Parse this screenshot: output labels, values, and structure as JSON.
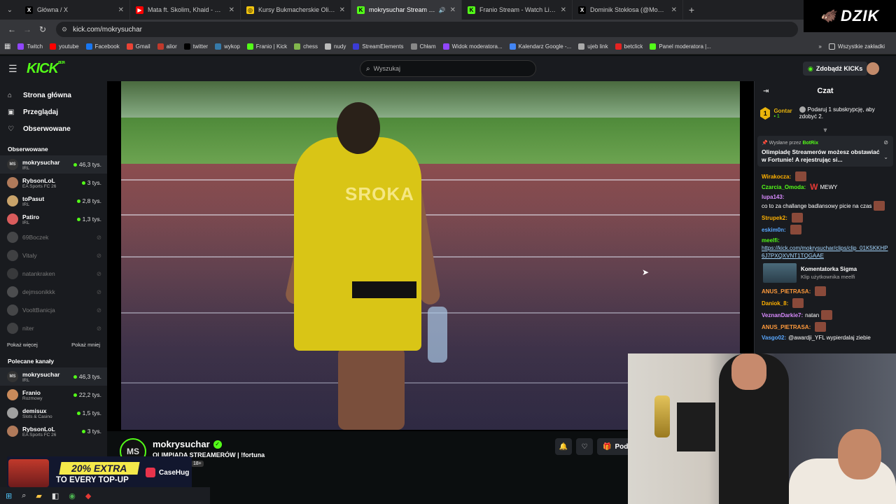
{
  "browser": {
    "tabs": [
      {
        "title": "Główna / X",
        "fav": "X",
        "fav_color": "#000000",
        "fav_text": "#ffffff"
      },
      {
        "title": "Mata ft. Skolim, Khaid - KAMIKA",
        "fav": "▶",
        "fav_color": "#ff0000",
        "fav_text": "#ffffff"
      },
      {
        "title": "Kursy Bukmacherskie Olimpiada",
        "fav": "◎",
        "fav_color": "#f1c40f",
        "fav_text": "#000000"
      },
      {
        "title": "mokrysuchar Stream - Watc",
        "fav": "K",
        "fav_color": "#53fc18",
        "fav_text": "#000000",
        "active": true
      },
      {
        "title": "Franio Stream - Watch Live on K",
        "fav": "K",
        "fav_color": "#53fc18",
        "fav_text": "#000000"
      },
      {
        "title": "Dominik Stokłosa (@MokrySuch",
        "fav": "X",
        "fav_color": "#000000",
        "fav_text": "#ffffff"
      }
    ],
    "url": "kick.com/mokrysuchar",
    "bookmarks": [
      {
        "label": "Twitch",
        "color": "#9146ff"
      },
      {
        "label": "youtube",
        "color": "#ff0000"
      },
      {
        "label": "Facebook",
        "color": "#1877f2"
      },
      {
        "label": "Gmail",
        "color": "#ea4335"
      },
      {
        "label": "alior",
        "color": "#c0392b"
      },
      {
        "label": "twitter",
        "color": "#000000"
      },
      {
        "label": "wykop",
        "color": "#367aa9"
      },
      {
        "label": "Franio | Kick",
        "color": "#53fc18"
      },
      {
        "label": "chess",
        "color": "#81b64c"
      },
      {
        "label": "nudy",
        "color": "#bbbbbb"
      },
      {
        "label": "StreamElements",
        "color": "#3b3bd6"
      },
      {
        "label": "Chłam",
        "color": "#888888"
      },
      {
        "label": "Widok moderatora...",
        "color": "#9146ff"
      },
      {
        "label": "Kalendarz Google -...",
        "color": "#4285f4"
      },
      {
        "label": "ujeb link",
        "color": "#aaaaaa"
      },
      {
        "label": "betclick",
        "color": "#e52321"
      },
      {
        "label": "Panel moderatora |...",
        "color": "#53fc18"
      }
    ],
    "all_bookmarks": "Wszystkie zakładki"
  },
  "dzik_logo": "DZIK",
  "kick": {
    "logo": "KICK",
    "logo_sup": "BETA",
    "search_placeholder": "Wyszukaj",
    "kicks_button": "Zdobądź KICKs"
  },
  "sidebar": {
    "nav": [
      {
        "label": "Strona główna",
        "icon": "⌂"
      },
      {
        "label": "Przeglądaj",
        "icon": "▣"
      },
      {
        "label": "Obserwowane",
        "icon": "♡"
      }
    ],
    "followed_title": "Obserwowane",
    "followed": [
      {
        "name": "mokrysuchar",
        "cat": "IRL",
        "viewers": "46,3 tys.",
        "live": true,
        "av": "MS",
        "color": "#333333"
      },
      {
        "name": "RybsonLoL",
        "cat": "EA Sports FC 26",
        "viewers": "3 tys.",
        "live": true,
        "av": "",
        "color": "#b07a5a"
      },
      {
        "name": "toPasut",
        "cat": "IRL",
        "viewers": "2,8 tys.",
        "live": true,
        "av": "",
        "color": "#c9a36a"
      },
      {
        "name": "Patiro",
        "cat": "IRL",
        "viewers": "1,3 tys.",
        "live": true,
        "av": "",
        "color": "#d95c5c"
      },
      {
        "name": "69Boczek",
        "live": false,
        "av": "",
        "color": "#888888"
      },
      {
        "name": "Vitaly",
        "live": false,
        "av": "",
        "color": "#777777"
      },
      {
        "name": "natankraken",
        "live": false,
        "av": "",
        "color": "#666666"
      },
      {
        "name": "dejmsonikkk",
        "live": false,
        "av": "",
        "color": "#999999"
      },
      {
        "name": "VooltBanicja",
        "live": false,
        "av": "",
        "color": "#888888"
      },
      {
        "name": "niter",
        "live": false,
        "av": "",
        "color": "#777777"
      }
    ],
    "show_more": "Pokaż więcej",
    "show_less": "Pokaż mniej",
    "recommended_title": "Polecane kanały",
    "recommended": [
      {
        "name": "mokrysuchar",
        "cat": "IRL",
        "viewers": "46,3 tys.",
        "live": true,
        "av": "MS",
        "color": "#333333"
      },
      {
        "name": "Franio",
        "cat": "Rozmowy",
        "viewers": "22,2 tys.",
        "live": true,
        "av": "",
        "color": "#c98a5a"
      },
      {
        "name": "demisux",
        "cat": "Slots & Casino",
        "viewers": "1,5 tys.",
        "live": true,
        "av": "",
        "color": "#a0a0a0"
      },
      {
        "name": "RybsonLoL",
        "cat": "EA Sports FC 26",
        "viewers": "3 tys.",
        "live": true,
        "av": "",
        "color": "#b07a5a"
      }
    ]
  },
  "video": {
    "shirt_text": "SROKA"
  },
  "streamer": {
    "avatar": "MS",
    "name": "mokrysuchar",
    "title": "OLIMPIADA STREAMERÓW | !fortuna",
    "age": "18+",
    "gift_label": "Podar"
  },
  "ad": {
    "headline": "20% EXTRA",
    "subline": "TO EVERY TOP-UP",
    "brand": "CaseHug"
  },
  "chat": {
    "title": "Czat",
    "leader": {
      "rank": "1",
      "name": "Gontar",
      "count": "1",
      "gift_text": "Podaruj 1 subskrypcję, aby zdobyć 2."
    },
    "pinned": {
      "sent_by": "Wysłane przez",
      "bot": "BotRix",
      "message": "Olimpiadę Streamerów możesz obstawiać w Fortunie! A rejestrując si..."
    },
    "messages": [
      {
        "user": "Wirakocza:",
        "color": "#ffb100",
        "text": "",
        "emote": true
      },
      {
        "user": "Czarcia_Omoda:",
        "color": "#53fc18",
        "text": "MEWY",
        "badge": "W"
      },
      {
        "user": "lupa143:",
        "color": "#d98bff",
        "text": "co to za challange badlansowy picie na czas",
        "emote": true
      },
      {
        "user": "Strupek2:",
        "color": "#ffb100",
        "text": "",
        "emote": true
      },
      {
        "user": "eskim0n:",
        "color": "#5aa8ff",
        "text": "",
        "emote": true
      },
      {
        "user": "meelfi:",
        "color": "#53fc18",
        "text": "",
        "link": "https://kick.com/mokrysuchar/clips/clip_01K5KKHP6J7PXQXVNT1TQGAAE"
      }
    ],
    "clip": {
      "title": "Komentatorka Sigma",
      "sub": "Klip użytkownika meelfi"
    },
    "messages2": [
      {
        "user": "ANUS_PIETRASA:",
        "color": "#ff9a3c",
        "text": "",
        "emote": true
      },
      {
        "user": "Daniok_8:",
        "color": "#ffb100",
        "text": "",
        "emote": true
      },
      {
        "user": "VeznanDarkie7:",
        "color": "#d98bff",
        "text": "natan",
        "emote": true
      },
      {
        "user": "ANUS_PIETRASA:",
        "color": "#ff9a3c",
        "text": "",
        "emote": true
      },
      {
        "user": "Vasgo02:",
        "color": "#5aa8ff",
        "text": "@awardji_YFL wypierdalaj ziebie"
      }
    ]
  }
}
